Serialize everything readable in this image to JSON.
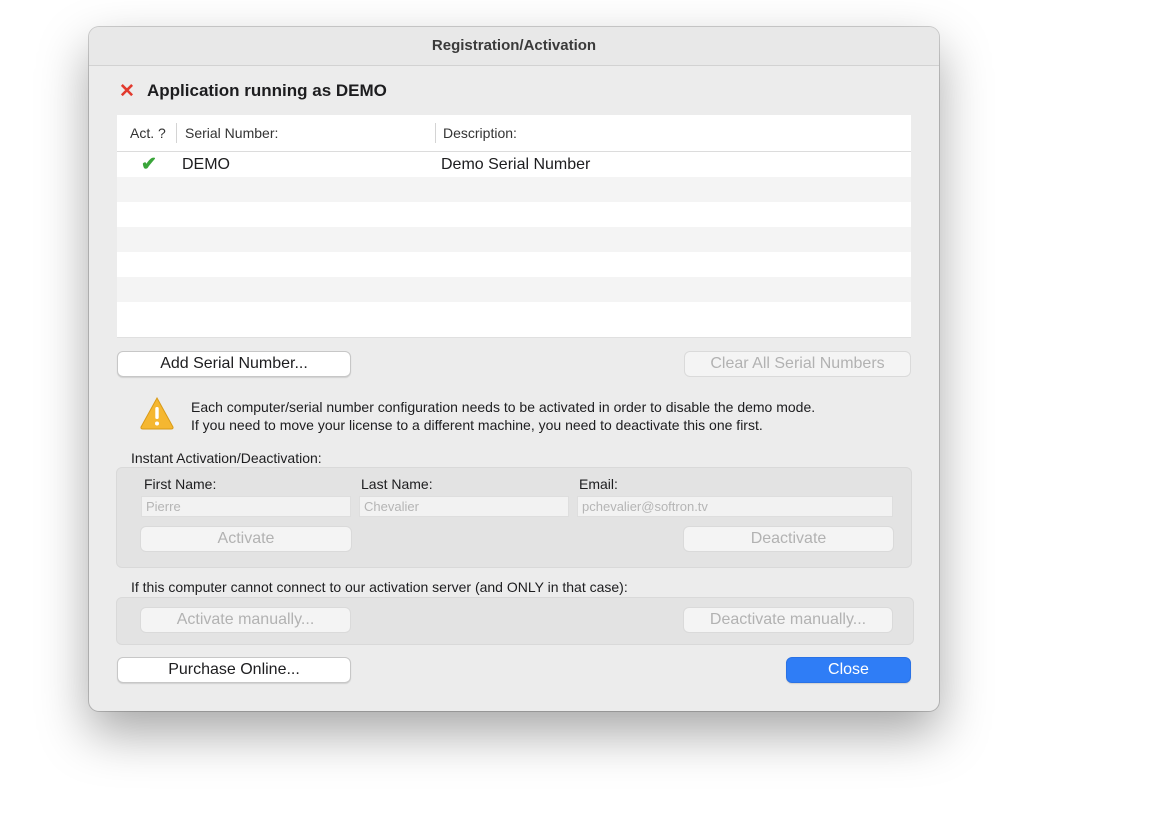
{
  "window": {
    "title": "Registration/Activation"
  },
  "status": {
    "icon": "red-x-icon",
    "text": "Application running as DEMO"
  },
  "table": {
    "headers": {
      "activated": "Act. ?",
      "serial": "Serial Number:",
      "description": "Description:"
    },
    "rows": [
      {
        "activated_icon": "green-check-icon",
        "activated_glyph": "✔",
        "serial": "DEMO",
        "description": "Demo Serial Number"
      }
    ]
  },
  "buttons": {
    "add_serial": "Add Serial Number...",
    "clear_all": "Clear All Serial Numbers",
    "activate": "Activate",
    "deactivate": "Deactivate",
    "activate_manually": "Activate manually...",
    "deactivate_manually": "Deactivate manually...",
    "purchase": "Purchase Online...",
    "close": "Close"
  },
  "warning": {
    "icon": "warning-triangle-icon",
    "line1": "Each computer/serial number configuration needs to be activated in order to disable the demo mode.",
    "line2": "If you need to move your license to a different machine, you need to deactivate this one first."
  },
  "instant": {
    "label": "Instant Activation/Deactivation:",
    "first_name_label": "First Name:",
    "last_name_label": "Last Name:",
    "email_label": "Email:",
    "first_name_value": "Pierre",
    "last_name_value": "Chevalier",
    "email_value": "pchevalier@softron.tv"
  },
  "manual": {
    "label": "If this computer cannot connect to our activation server (and ONLY in that case):"
  },
  "colors": {
    "accent": "#2f7df6",
    "error": "#e23a2e",
    "success": "#3aa53a",
    "warning": "#f5b731"
  }
}
